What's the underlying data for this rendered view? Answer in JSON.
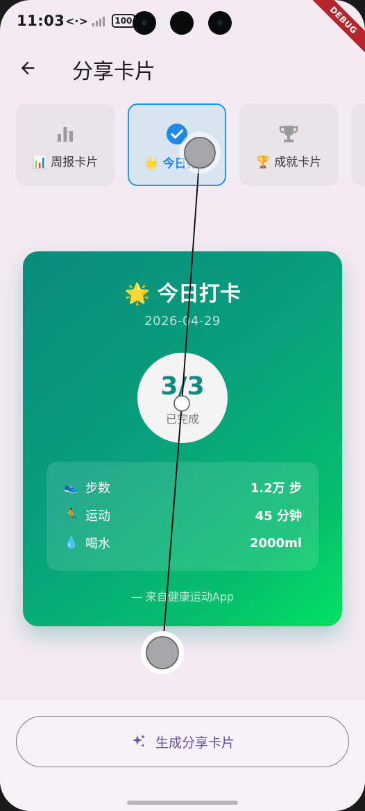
{
  "status_bar": {
    "time": "11:03",
    "nfc": "<·>",
    "battery": "100"
  },
  "debug_banner": "DEBUG",
  "app_bar": {
    "title": "分享卡片"
  },
  "tabs": [
    {
      "label": "📊 周报卡片",
      "icon": "bar-chart-icon",
      "selected": false
    },
    {
      "label": "🌟 今日打卡",
      "icon": "check-circle-icon",
      "selected": true
    },
    {
      "label": "🏆 成就卡片",
      "icon": "trophy-icon",
      "selected": false
    }
  ],
  "card": {
    "title": "🌟 今日打卡",
    "date": "2026-04-29",
    "progress_value": "3/3",
    "progress_caption": "已完成",
    "stats": [
      {
        "emoji": "👟",
        "label": "步数",
        "value": "1.2万 步"
      },
      {
        "emoji": "🏃",
        "label": "运动",
        "value": "45 分钟"
      },
      {
        "emoji": "💧",
        "label": "喝水",
        "value": "2000ml"
      }
    ],
    "footer": "— 来自健康运动App",
    "gradient_colors": [
      "#0a8b7b",
      "#02e263"
    ]
  },
  "generate_button": {
    "label": "生成分享卡片",
    "icon": "sparkle-icon"
  },
  "colors": {
    "background": "#f4eaf3",
    "accent_blue": "#2196f3",
    "button_text": "#6a4fa3",
    "progress_text": "#138a82"
  }
}
